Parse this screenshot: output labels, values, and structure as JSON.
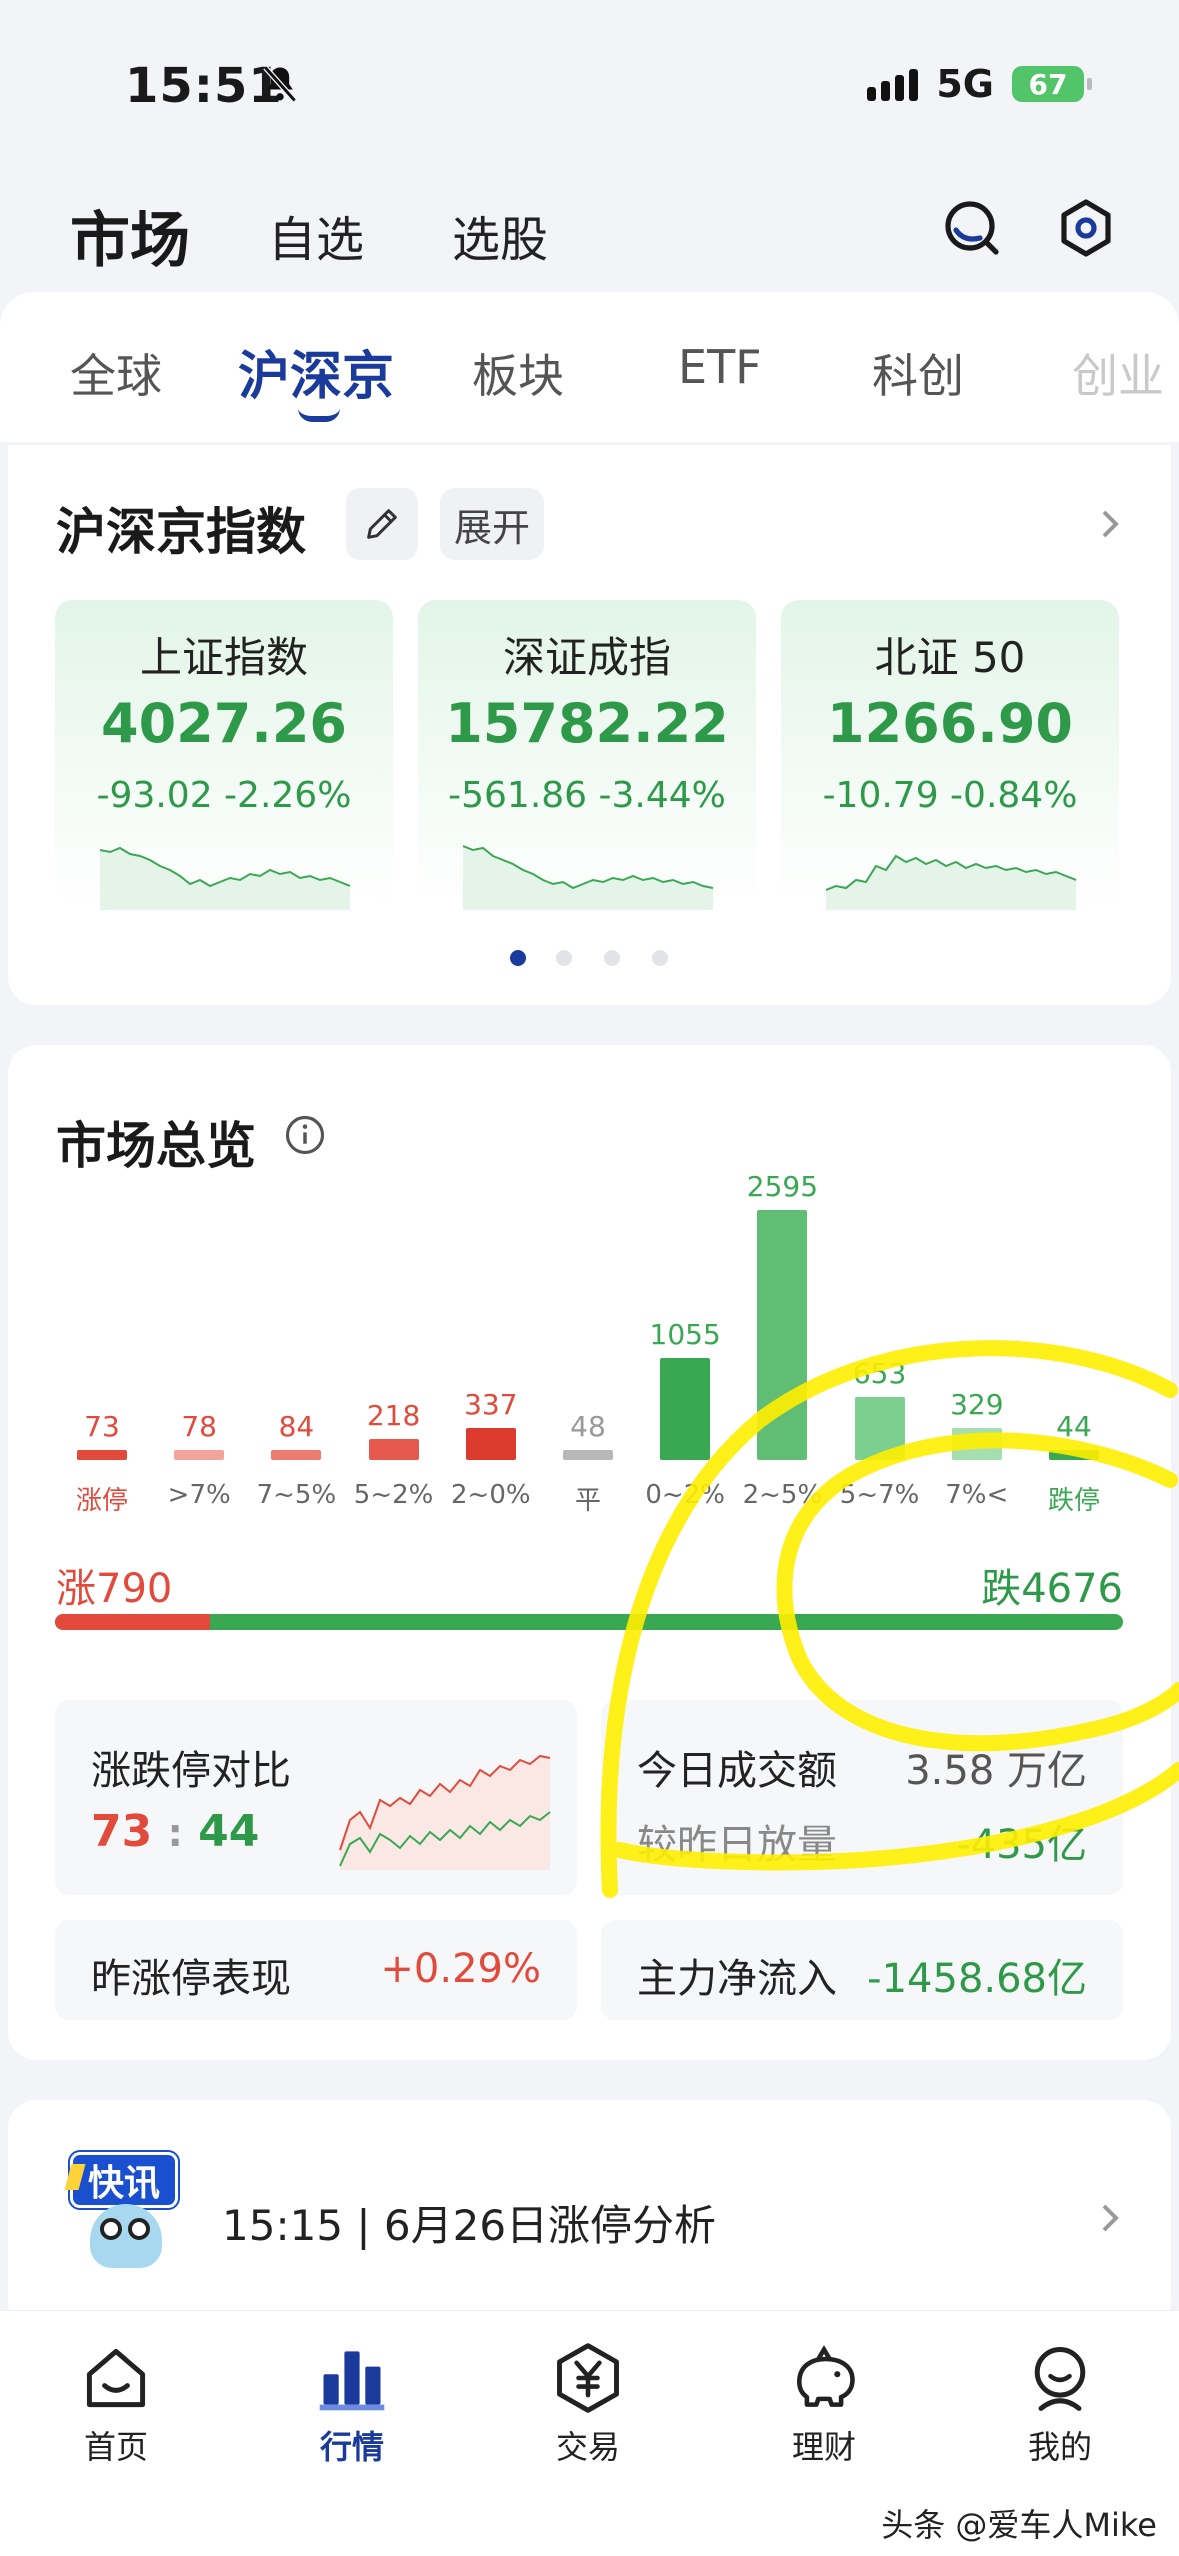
{
  "status": {
    "time": "15:51",
    "network": "5G",
    "battery": "67"
  },
  "header": {
    "title": "市场",
    "tabs": [
      "自选",
      "选股"
    ]
  },
  "category_tabs": [
    "全球",
    "沪深京",
    "板块",
    "ETF",
    "科创",
    "创业"
  ],
  "indices_section": {
    "title": "沪深京指数",
    "expand_label": "展开",
    "cards": [
      {
        "name": "上证指数",
        "value": "4027.26",
        "change": "-93.02 -2.26%"
      },
      {
        "name": "深证成指",
        "value": "15782.22",
        "change": "-561.86 -3.44%"
      },
      {
        "name": "北证 50",
        "value": "1266.90",
        "change": "-10.79 -0.84%"
      }
    ]
  },
  "market_overview": {
    "title": "市场总览",
    "up_total": "涨790",
    "down_total": "跌4676",
    "up_fraction": 0.145,
    "limit_compare": {
      "label": "涨跌停对比",
      "up": "73",
      "sep": ":",
      "down": "44"
    },
    "turnover": {
      "label": "今日成交额",
      "value": "3.58 万亿",
      "compare_label": "较昨日放量",
      "compare_value": "-435亿"
    },
    "yesterday_limit": {
      "label": "昨涨停表现",
      "value": "+0.29%"
    },
    "main_inflow": {
      "label": "主力净流入",
      "value": "-1458.68亿"
    }
  },
  "chart_data": {
    "type": "bar",
    "categories": [
      "涨停",
      ">7%",
      "7~5%",
      "5~2%",
      "2~0%",
      "平",
      "0~2%",
      "2~5%",
      "5~7%",
      "7%<",
      "跌停"
    ],
    "values": [
      73,
      78,
      84,
      218,
      337,
      48,
      1055,
      2595,
      653,
      329,
      44
    ],
    "colors": [
      "#e24a3c",
      "#f2a39a",
      "#ec7c70",
      "#e55a4c",
      "#dc3b2e",
      "#b8b8b8",
      "#3aa853",
      "#62bd74",
      "#7ccf8e",
      "#a5dfb1",
      "#3aa853"
    ]
  },
  "news": {
    "badge": "快讯",
    "text": "15:15 | 6月26日涨停分析"
  },
  "bottom_nav": [
    {
      "label": "首页",
      "icon": "home-icon"
    },
    {
      "label": "行情",
      "icon": "market-chart-icon"
    },
    {
      "label": "交易",
      "icon": "trade-yen-icon"
    },
    {
      "label": "理财",
      "icon": "piggy-bank-icon"
    },
    {
      "label": "我的",
      "icon": "profile-icon"
    }
  ],
  "watermark": "头条 @爱车人Mike"
}
